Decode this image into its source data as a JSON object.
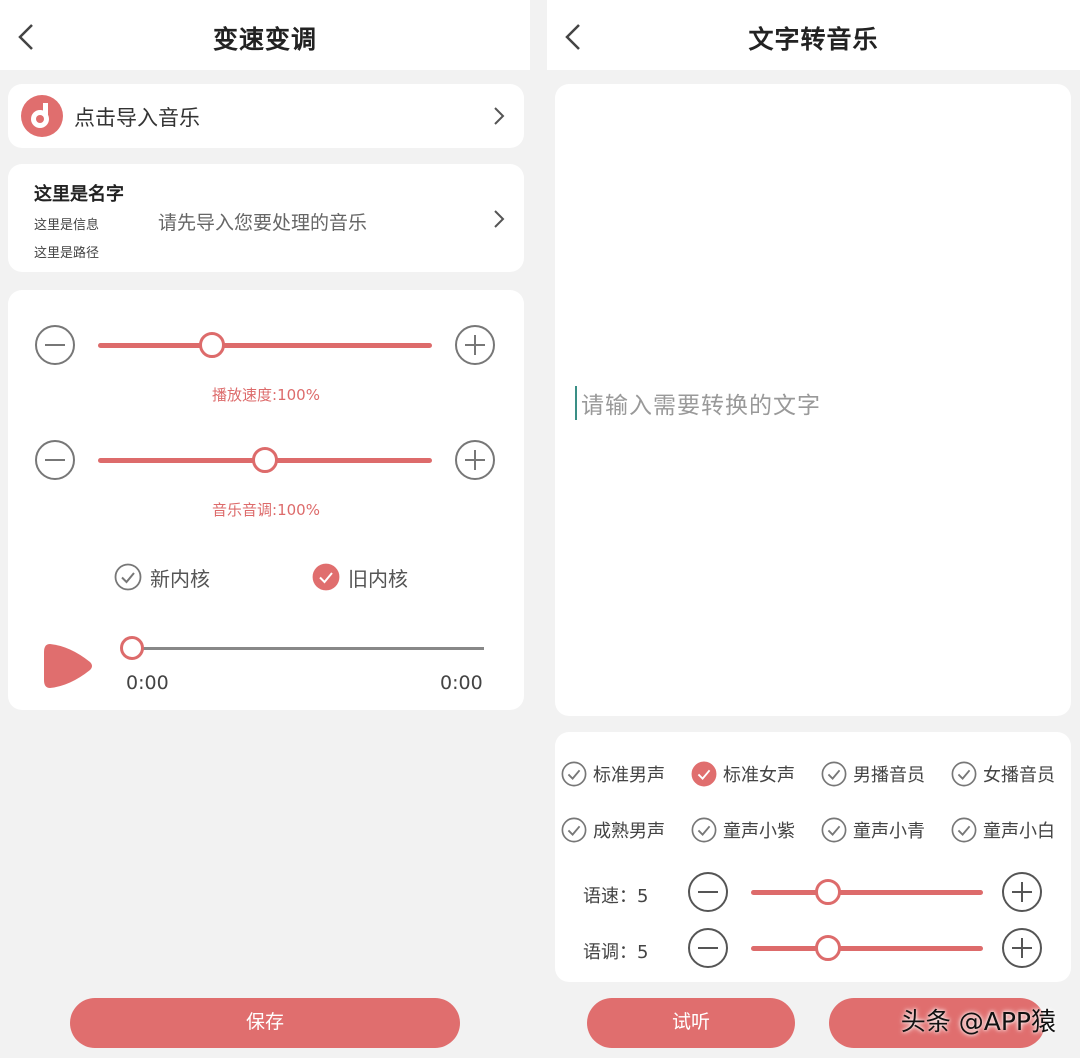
{
  "left": {
    "title": "变速变调",
    "import_label": "点击导入音乐",
    "info": {
      "name": "这里是名字",
      "info_line": "这里是信息",
      "path_line": "这里是路径",
      "hint": "请先导入您要处理的音乐"
    },
    "speed": {
      "caption": "播放速度:100%",
      "level": 0.34
    },
    "pitch": {
      "caption": "音乐音调:100%",
      "level": 0.5
    },
    "kernels": [
      {
        "label": "新内核",
        "checked": false
      },
      {
        "label": "旧内核",
        "checked": true
      }
    ],
    "player": {
      "start_time": "0:00",
      "end_time": "0:00",
      "progress": 0
    },
    "save_label": "保存"
  },
  "right": {
    "title": "文字转音乐",
    "text_placeholder": "请输入需要转换的文字",
    "voices": [
      {
        "label": "标准男声",
        "checked": false
      },
      {
        "label": "标准女声",
        "checked": true
      },
      {
        "label": "男播音员",
        "checked": false
      },
      {
        "label": "女播音员",
        "checked": false
      },
      {
        "label": "成熟男声",
        "checked": false
      },
      {
        "label": "童声小紫",
        "checked": false
      },
      {
        "label": "童声小青",
        "checked": false
      },
      {
        "label": "童声小白",
        "checked": false
      }
    ],
    "rate": {
      "label": "语速：5",
      "level": 0.33
    },
    "tone": {
      "label": "语调：5",
      "level": 0.33
    },
    "preview_label": "试听"
  },
  "watermark": "头条 @APP猿",
  "colors": {
    "accent": "#e06e6e",
    "background": "#f2f2f2",
    "card": "#ffffff"
  },
  "icons": {
    "back": "chevron-left-icon",
    "music": "music-note-icon",
    "forward": "chevron-right-icon",
    "minus": "minus-circle-icon",
    "plus": "plus-circle-icon",
    "check": "check-circle-icon",
    "play": "play-icon"
  }
}
